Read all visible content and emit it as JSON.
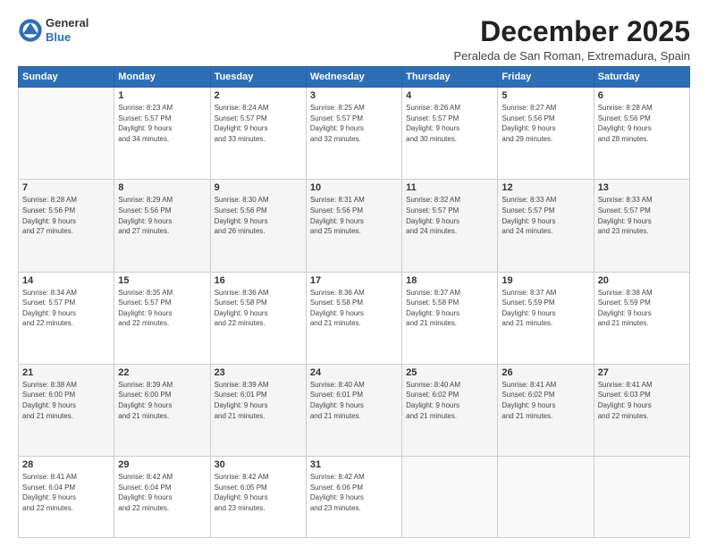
{
  "logo": {
    "general": "General",
    "blue": "Blue"
  },
  "title": "December 2025",
  "subtitle": "Peraleda de San Roman, Extremadura, Spain",
  "weekdays": [
    "Sunday",
    "Monday",
    "Tuesday",
    "Wednesday",
    "Thursday",
    "Friday",
    "Saturday"
  ],
  "weeks": [
    [
      {
        "day": "",
        "info": ""
      },
      {
        "day": "1",
        "info": "Sunrise: 8:23 AM\nSunset: 5:57 PM\nDaylight: 9 hours\nand 34 minutes."
      },
      {
        "day": "2",
        "info": "Sunrise: 8:24 AM\nSunset: 5:57 PM\nDaylight: 9 hours\nand 33 minutes."
      },
      {
        "day": "3",
        "info": "Sunrise: 8:25 AM\nSunset: 5:57 PM\nDaylight: 9 hours\nand 32 minutes."
      },
      {
        "day": "4",
        "info": "Sunrise: 8:26 AM\nSunset: 5:57 PM\nDaylight: 9 hours\nand 30 minutes."
      },
      {
        "day": "5",
        "info": "Sunrise: 8:27 AM\nSunset: 5:56 PM\nDaylight: 9 hours\nand 29 minutes."
      },
      {
        "day": "6",
        "info": "Sunrise: 8:28 AM\nSunset: 5:56 PM\nDaylight: 9 hours\nand 28 minutes."
      }
    ],
    [
      {
        "day": "7",
        "info": "Sunrise: 8:28 AM\nSunset: 5:56 PM\nDaylight: 9 hours\nand 27 minutes."
      },
      {
        "day": "8",
        "info": "Sunrise: 8:29 AM\nSunset: 5:56 PM\nDaylight: 9 hours\nand 27 minutes."
      },
      {
        "day": "9",
        "info": "Sunrise: 8:30 AM\nSunset: 5:56 PM\nDaylight: 9 hours\nand 26 minutes."
      },
      {
        "day": "10",
        "info": "Sunrise: 8:31 AM\nSunset: 5:56 PM\nDaylight: 9 hours\nand 25 minutes."
      },
      {
        "day": "11",
        "info": "Sunrise: 8:32 AM\nSunset: 5:57 PM\nDaylight: 9 hours\nand 24 minutes."
      },
      {
        "day": "12",
        "info": "Sunrise: 8:33 AM\nSunset: 5:57 PM\nDaylight: 9 hours\nand 24 minutes."
      },
      {
        "day": "13",
        "info": "Sunrise: 8:33 AM\nSunset: 5:57 PM\nDaylight: 9 hours\nand 23 minutes."
      }
    ],
    [
      {
        "day": "14",
        "info": "Sunrise: 8:34 AM\nSunset: 5:57 PM\nDaylight: 9 hours\nand 22 minutes."
      },
      {
        "day": "15",
        "info": "Sunrise: 8:35 AM\nSunset: 5:57 PM\nDaylight: 9 hours\nand 22 minutes."
      },
      {
        "day": "16",
        "info": "Sunrise: 8:36 AM\nSunset: 5:58 PM\nDaylight: 9 hours\nand 22 minutes."
      },
      {
        "day": "17",
        "info": "Sunrise: 8:36 AM\nSunset: 5:58 PM\nDaylight: 9 hours\nand 21 minutes."
      },
      {
        "day": "18",
        "info": "Sunrise: 8:37 AM\nSunset: 5:58 PM\nDaylight: 9 hours\nand 21 minutes."
      },
      {
        "day": "19",
        "info": "Sunrise: 8:37 AM\nSunset: 5:59 PM\nDaylight: 9 hours\nand 21 minutes."
      },
      {
        "day": "20",
        "info": "Sunrise: 8:38 AM\nSunset: 5:59 PM\nDaylight: 9 hours\nand 21 minutes."
      }
    ],
    [
      {
        "day": "21",
        "info": "Sunrise: 8:38 AM\nSunset: 6:00 PM\nDaylight: 9 hours\nand 21 minutes."
      },
      {
        "day": "22",
        "info": "Sunrise: 8:39 AM\nSunset: 6:00 PM\nDaylight: 9 hours\nand 21 minutes."
      },
      {
        "day": "23",
        "info": "Sunrise: 8:39 AM\nSunset: 6:01 PM\nDaylight: 9 hours\nand 21 minutes."
      },
      {
        "day": "24",
        "info": "Sunrise: 8:40 AM\nSunset: 6:01 PM\nDaylight: 9 hours\nand 21 minutes."
      },
      {
        "day": "25",
        "info": "Sunrise: 8:40 AM\nSunset: 6:02 PM\nDaylight: 9 hours\nand 21 minutes."
      },
      {
        "day": "26",
        "info": "Sunrise: 8:41 AM\nSunset: 6:02 PM\nDaylight: 9 hours\nand 21 minutes."
      },
      {
        "day": "27",
        "info": "Sunrise: 8:41 AM\nSunset: 6:03 PM\nDaylight: 9 hours\nand 22 minutes."
      }
    ],
    [
      {
        "day": "28",
        "info": "Sunrise: 8:41 AM\nSunset: 6:04 PM\nDaylight: 9 hours\nand 22 minutes."
      },
      {
        "day": "29",
        "info": "Sunrise: 8:42 AM\nSunset: 6:04 PM\nDaylight: 9 hours\nand 22 minutes."
      },
      {
        "day": "30",
        "info": "Sunrise: 8:42 AM\nSunset: 6:05 PM\nDaylight: 9 hours\nand 23 minutes."
      },
      {
        "day": "31",
        "info": "Sunrise: 8:42 AM\nSunset: 6:06 PM\nDaylight: 9 hours\nand 23 minutes."
      },
      {
        "day": "",
        "info": ""
      },
      {
        "day": "",
        "info": ""
      },
      {
        "day": "",
        "info": ""
      }
    ]
  ]
}
